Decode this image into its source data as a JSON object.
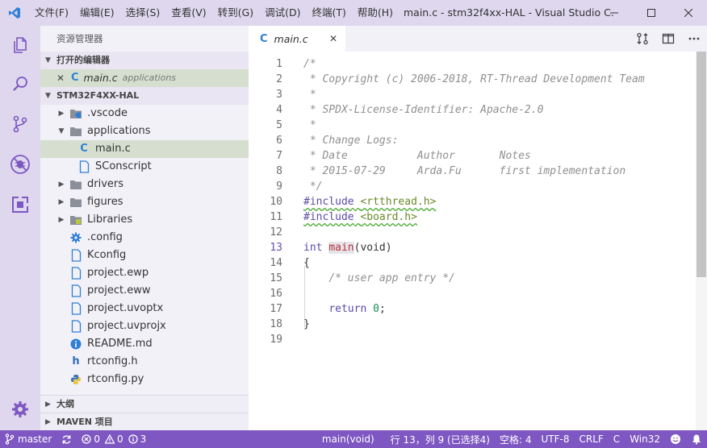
{
  "titlebar": {
    "menu": [
      "文件(F)",
      "编辑(E)",
      "选择(S)",
      "查看(V)",
      "转到(G)",
      "调试(D)",
      "终端(T)",
      "帮助(H)"
    ],
    "window_title": "main.c - stm32f4xx-HAL - Visual Studio C..."
  },
  "sidebar": {
    "title": "资源管理器",
    "open_editors": {
      "header": "打开的编辑器",
      "items": [
        {
          "name": "main.c",
          "dir": "applications"
        }
      ]
    },
    "project": {
      "header": "STM32F4XX-HAL",
      "items": [
        {
          "label": ".vscode",
          "indent": 0,
          "type": "folder-vscode",
          "twisty": "closed"
        },
        {
          "label": "applications",
          "indent": 0,
          "type": "folder",
          "twisty": "open"
        },
        {
          "label": "main.c",
          "indent": 1,
          "type": "c",
          "twisty": "",
          "selected": true
        },
        {
          "label": "SConscript",
          "indent": 1,
          "type": "file",
          "twisty": ""
        },
        {
          "label": "drivers",
          "indent": 0,
          "type": "folder",
          "twisty": "closed"
        },
        {
          "label": "figures",
          "indent": 0,
          "type": "folder",
          "twisty": "closed"
        },
        {
          "label": "Libraries",
          "indent": 0,
          "type": "folder-lib",
          "twisty": "closed"
        },
        {
          "label": ".config",
          "indent": 0,
          "type": "config",
          "twisty": ""
        },
        {
          "label": "Kconfig",
          "indent": 0,
          "type": "file",
          "twisty": ""
        },
        {
          "label": "project.ewp",
          "indent": 0,
          "type": "file",
          "twisty": ""
        },
        {
          "label": "project.eww",
          "indent": 0,
          "type": "file",
          "twisty": ""
        },
        {
          "label": "project.uvoptx",
          "indent": 0,
          "type": "file",
          "twisty": ""
        },
        {
          "label": "project.uvprojx",
          "indent": 0,
          "type": "file",
          "twisty": ""
        },
        {
          "label": "README.md",
          "indent": 0,
          "type": "info",
          "twisty": ""
        },
        {
          "label": "rtconfig.h",
          "indent": 0,
          "type": "h",
          "twisty": ""
        },
        {
          "label": "rtconfig.py",
          "indent": 0,
          "type": "python",
          "twisty": ""
        }
      ]
    },
    "outline_header": "大纲",
    "maven_header": "MAVEN 项目"
  },
  "editor": {
    "tab_label": "main.c",
    "current_line": 13,
    "lines": [
      "/*",
      " * Copyright (c) 2006-2018, RT-Thread Development Team",
      " *",
      " * SPDX-License-Identifier: Apache-2.0",
      " *",
      " * Change Logs:",
      " * Date           Author       Notes",
      " * 2015-07-29     Arda.Fu      first implementation",
      " */",
      "#include <rtthread.h>",
      "#include <board.h>",
      "",
      "int main(void)",
      "{",
      "    /* user app entry */",
      "",
      "    return 0;",
      "}",
      ""
    ]
  },
  "statusbar": {
    "branch": "master",
    "errors": "0",
    "warnings": "0",
    "info": "3",
    "scope": "main(void)",
    "position": "行 13，列 9 (已选择4)",
    "indent": "空格: 4",
    "encoding": "UTF-8",
    "eol": "CRLF",
    "language": "C",
    "platform": "Win32"
  },
  "colors": {
    "titlebar": "#ded7ee",
    "statusbar": "#7e57c2",
    "selection": "#d6dfcf"
  }
}
